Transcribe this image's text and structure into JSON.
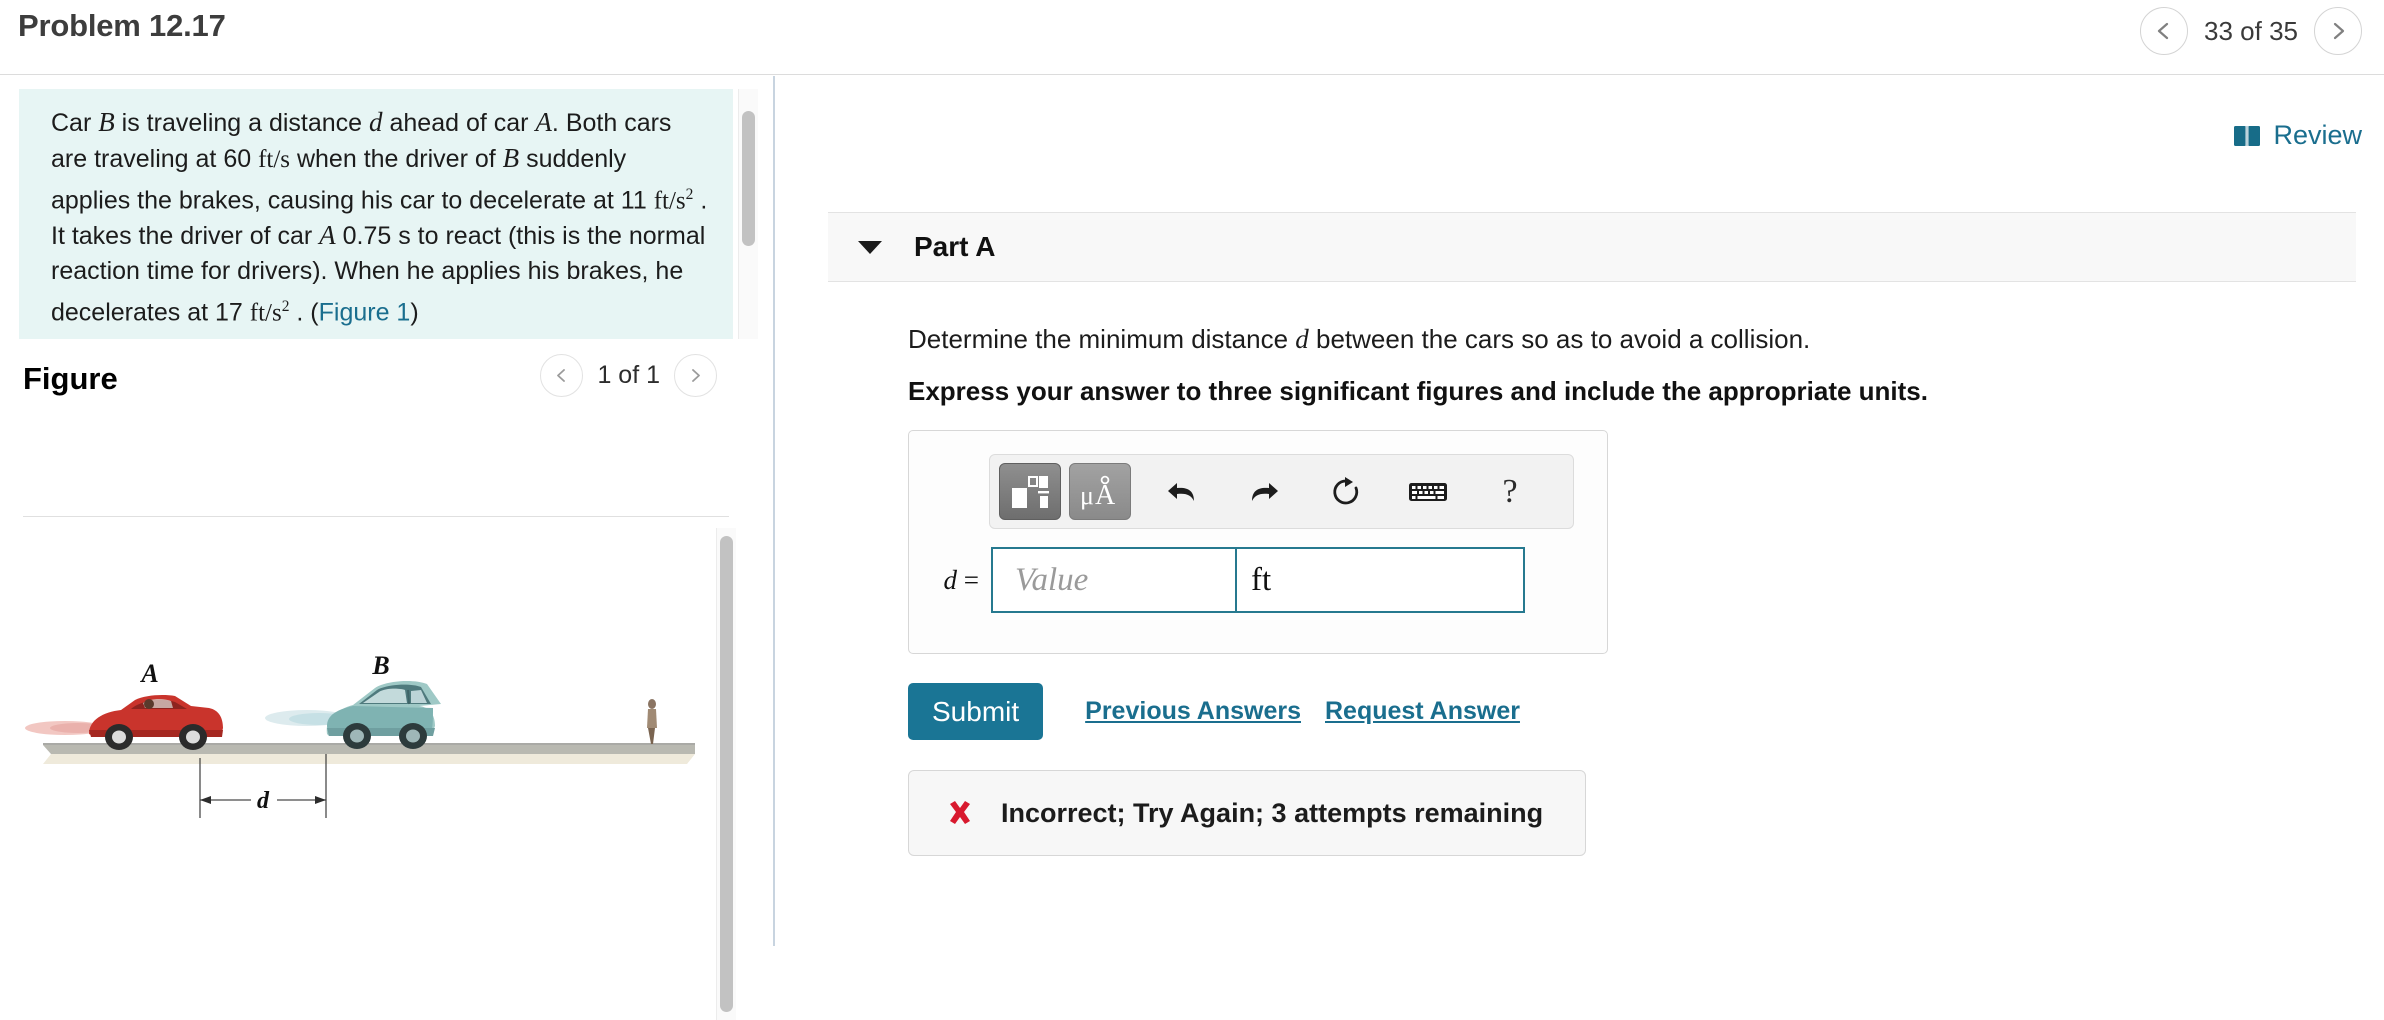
{
  "header": {
    "problem_title": "Problem 12.17",
    "pager_label": "33 of 35",
    "prev_icon": "chevron-left-icon",
    "next_icon": "chevron-right-icon"
  },
  "left_panel": {
    "statement": {
      "t1": "Car ",
      "v1": "B",
      "t2": " is traveling a distance ",
      "v2": "d",
      "t3": " ahead of car ",
      "v3": "A",
      "t4": ". Both cars are traveling at 60 ",
      "u1": "ft/s",
      "t5": " when the driver of ",
      "v4": "B",
      "t6": " suddenly applies the brakes, causing his car to decelerate at 11 ",
      "u2": "ft/s",
      "exp2": "2",
      "t7": " . It takes the driver of car ",
      "v5": "A",
      "t8": " 0.75 s to react (this is the normal reaction time for drivers). When he applies his brakes, he decelerates at 17 ",
      "u3": "ft/s",
      "exp3": "2",
      "t9": " . (",
      "figure_link": "Figure 1",
      "t10": ")"
    },
    "figure": {
      "title": "Figure",
      "pager_label": "1 of 1",
      "prev_icon": "chevron-left-icon",
      "next_icon": "chevron-right-icon",
      "label_a": "A",
      "label_b": "B",
      "label_d": "d"
    }
  },
  "right_panel": {
    "review_label": "Review",
    "review_icon": "book-icon",
    "part": {
      "label": "Part A",
      "collapse_icon": "caret-down-icon",
      "question": "Determine the minimum distance d between the cars so as to avoid a collision.",
      "question_pre": "Determine the minimum distance ",
      "question_var": "d",
      "question_post": " between the cars so as to avoid a collision.",
      "instruction": "Express your answer to three significant figures and include the appropriate units."
    },
    "answer": {
      "toolbar": [
        {
          "name": "math-template-icon",
          "label": ""
        },
        {
          "name": "units-icon",
          "label": "μÅ"
        },
        {
          "name": "undo-icon",
          "label": ""
        },
        {
          "name": "redo-icon",
          "label": ""
        },
        {
          "name": "reset-icon",
          "label": ""
        },
        {
          "name": "keyboard-icon",
          "label": ""
        },
        {
          "name": "help-icon",
          "label": "?"
        }
      ],
      "lhs_var": "d",
      "lhs_eq": "=",
      "value_placeholder": "Value",
      "units_value": "ft"
    },
    "actions": {
      "submit_label": "Submit",
      "previous_answers_label": "Previous Answers",
      "request_answer_label": "Request Answer"
    },
    "feedback": {
      "icon": "x-mark-icon",
      "message": "Incorrect; Try Again; 3 attempts remaining"
    }
  },
  "colors": {
    "accent_teal": "#1a6e8e",
    "submit_teal": "#1a7595",
    "statement_bg": "#e7f5f4",
    "error_red": "#d8192e",
    "input_border": "#26798f"
  }
}
